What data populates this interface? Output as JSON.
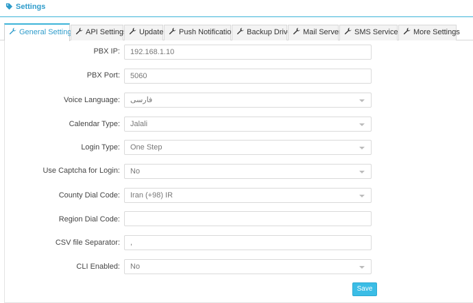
{
  "header": {
    "title": "Settings",
    "icon": "tag-icon",
    "accent": "#2f9ccb"
  },
  "tabs": [
    {
      "label": "General Settings",
      "active": true
    },
    {
      "label": "API Settings"
    },
    {
      "label": "Update"
    },
    {
      "label": "Push Notification"
    },
    {
      "label": "Backup Drive"
    },
    {
      "label": "Mail Server"
    },
    {
      "label": "SMS Services"
    },
    {
      "label": "More Settings"
    }
  ],
  "form": {
    "pbx_ip": {
      "label": "PBX IP:",
      "value": "192.168.1.10"
    },
    "pbx_port": {
      "label": "PBX Port:",
      "value": "5060"
    },
    "voice_language": {
      "label": "Voice Language:",
      "value": "فارسی"
    },
    "calendar_type": {
      "label": "Calendar Type:",
      "value": "Jalali"
    },
    "login_type": {
      "label": "Login Type:",
      "value": "One Step"
    },
    "use_captcha": {
      "label": "Use Captcha for Login:",
      "value": "No"
    },
    "county_dial_code": {
      "label": "County Dial Code:",
      "value": "Iran (+98) IR"
    },
    "region_dial_code": {
      "label": "Region Dial Code:",
      "value": ""
    },
    "csv_separator": {
      "label": "CSV file Separator:",
      "value": ","
    },
    "cli_enabled": {
      "label": "CLI Enabled:",
      "value": "No"
    }
  },
  "actions": {
    "save_label": "Save",
    "save_color": "#3bbde6"
  }
}
